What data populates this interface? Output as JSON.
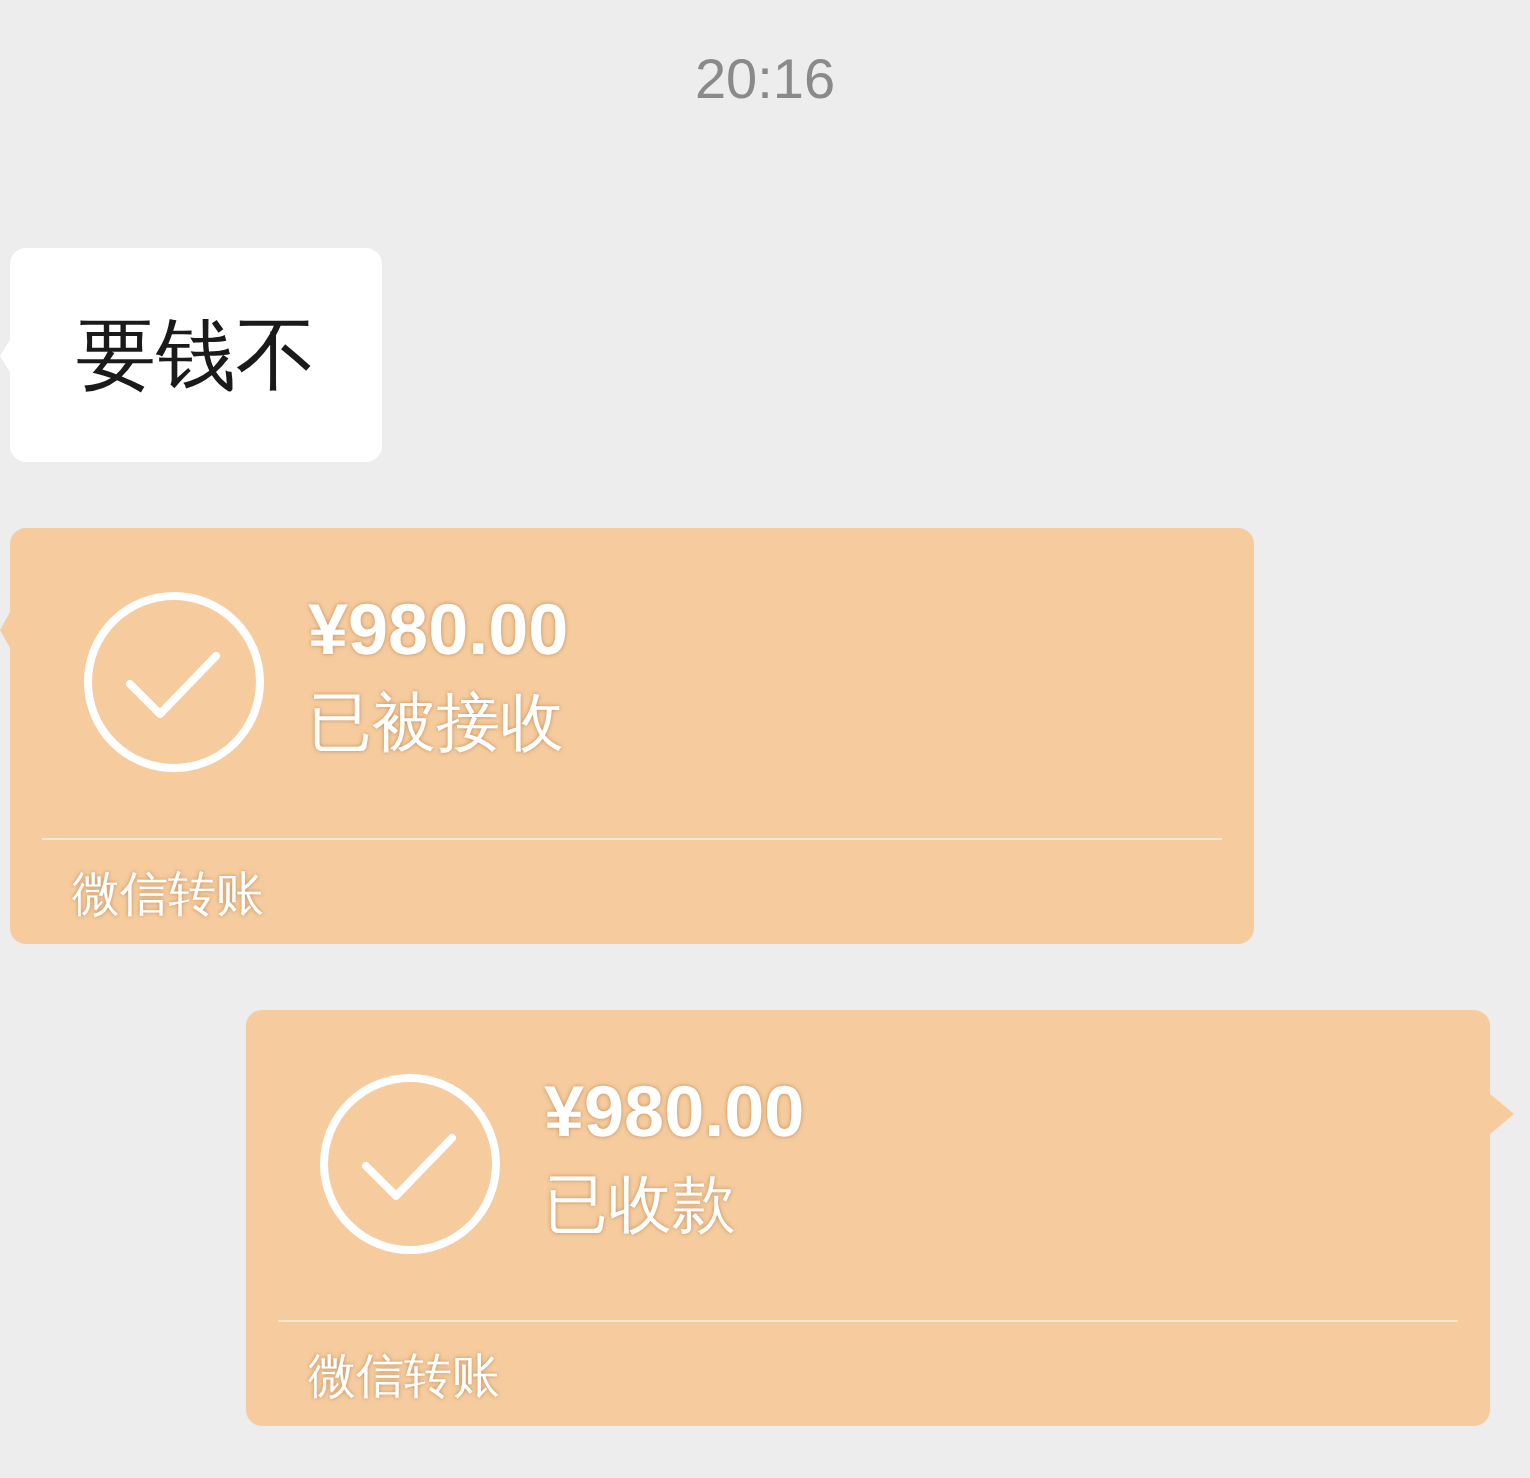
{
  "time": "20:16",
  "messages": [
    {
      "kind": "text",
      "outgoing": false,
      "text": "要钱不"
    },
    {
      "kind": "transfer",
      "outgoing": false,
      "amount": "¥980.00",
      "status": "已被接收",
      "label": "微信转账"
    },
    {
      "kind": "transfer",
      "outgoing": true,
      "amount": "¥980.00",
      "status": "已收款",
      "label": "微信转账"
    }
  ]
}
